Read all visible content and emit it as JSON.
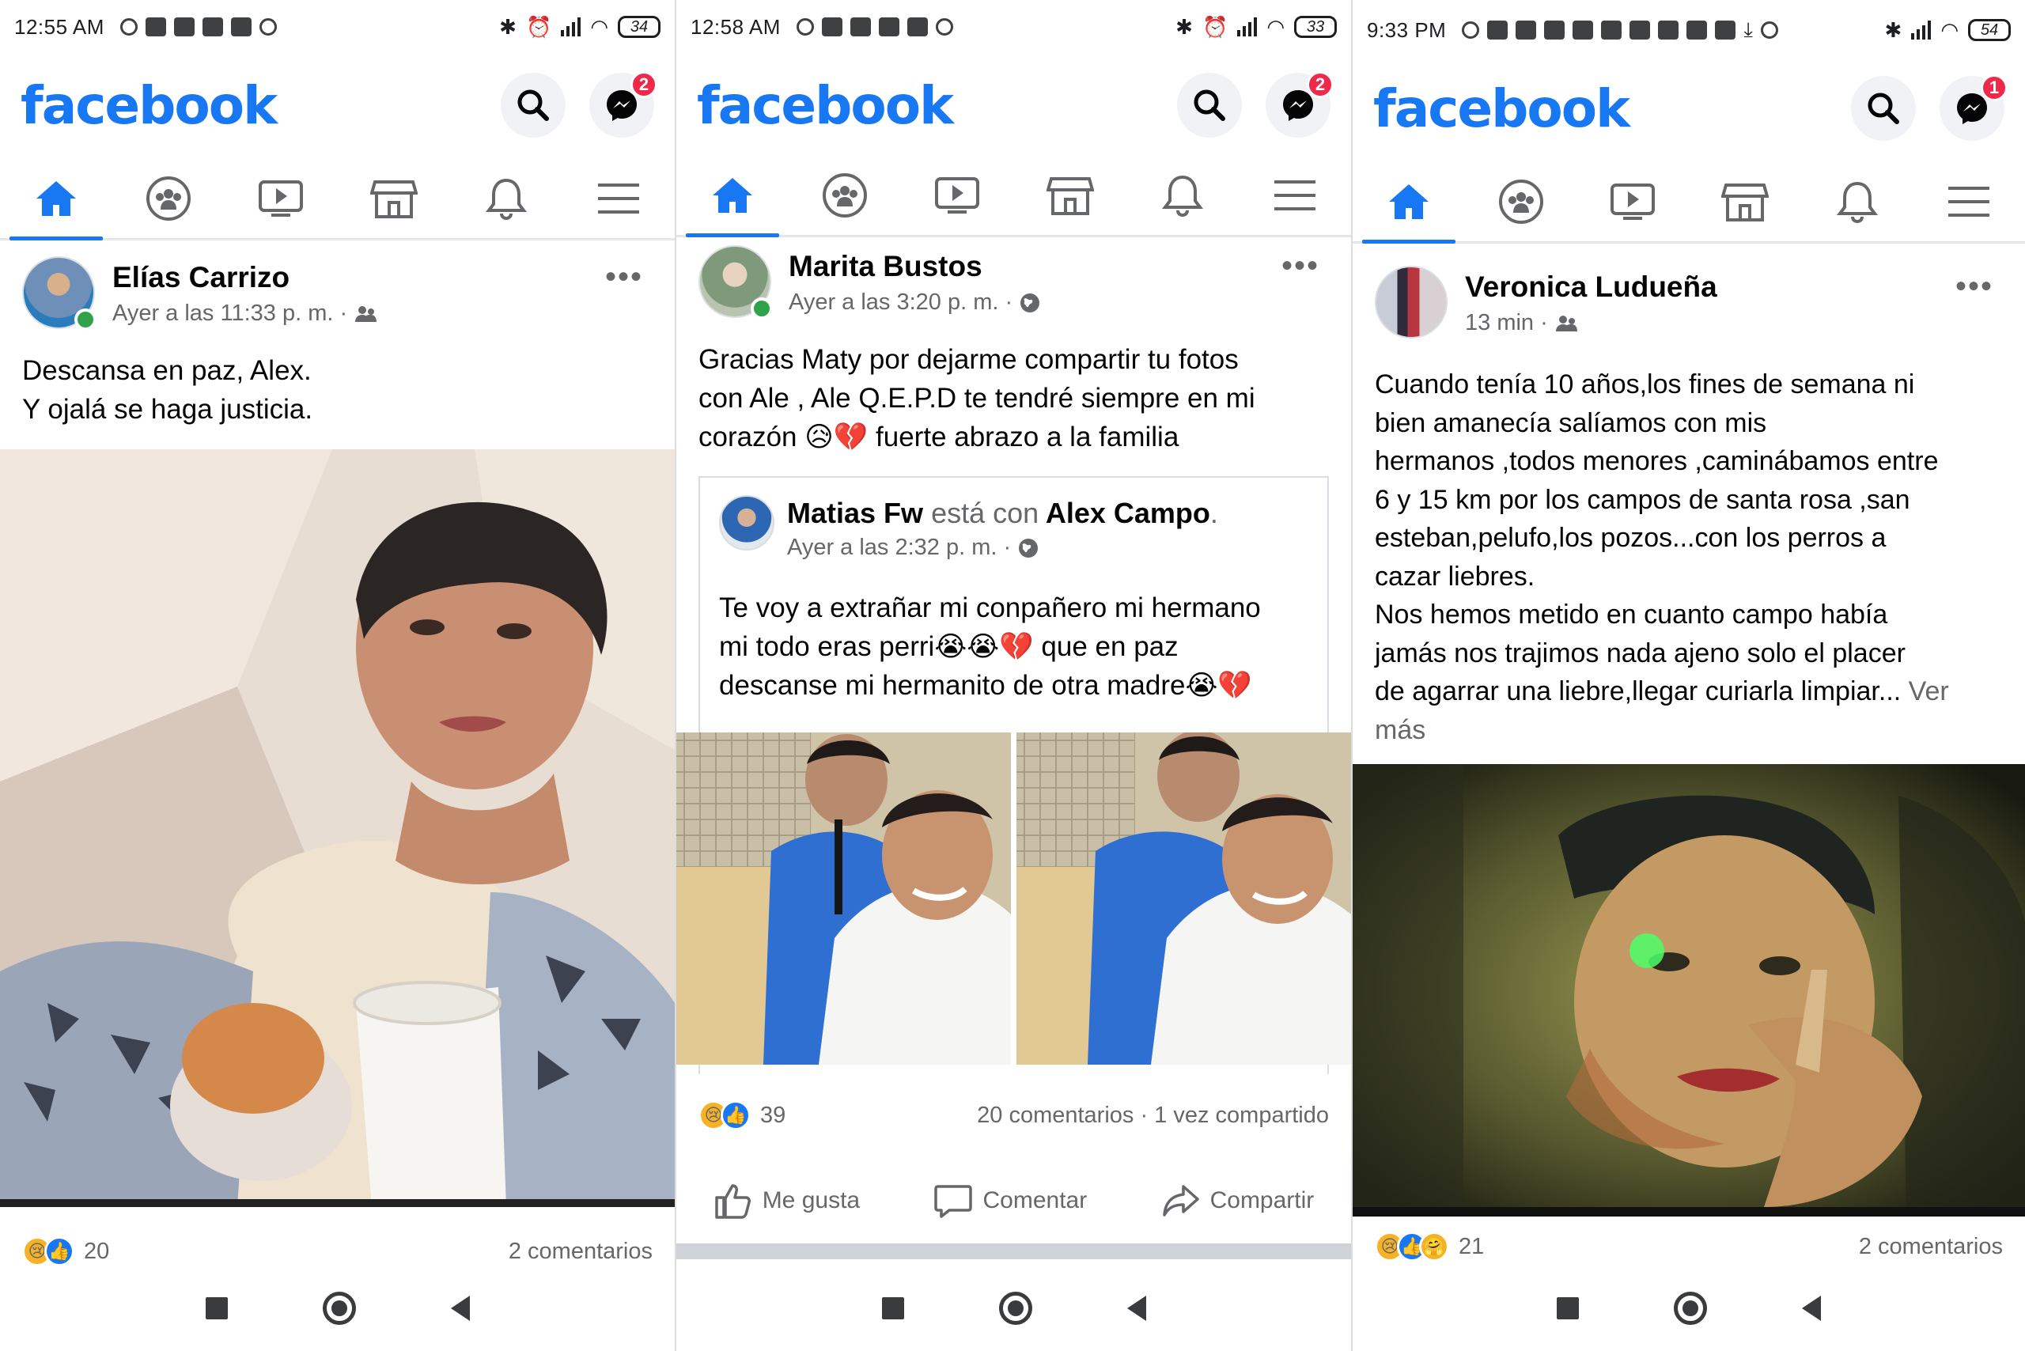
{
  "colors": {
    "brand": "#1877f2",
    "online": "#31a24c",
    "badge": "#f02849",
    "meta": "#65676b"
  },
  "panels": [
    {
      "status": {
        "time": "12:55 AM",
        "battery": "34"
      },
      "header": {
        "logo": "facebook",
        "messenger_badge": "2"
      },
      "tabs": [
        "home-icon",
        "groups-icon",
        "watch-icon",
        "marketplace-icon",
        "notifications-icon",
        "menu-icon"
      ],
      "post": {
        "author": "Elías Carrizo",
        "meta": "Ayer a las 11:33 p. m. ·",
        "privacy_icon": "friends-icon",
        "text": [
          "Descansa en paz, Alex.",
          "Y ojalá se haga justicia."
        ],
        "reaction_count": "20",
        "comments": "2 comentarios"
      }
    },
    {
      "status": {
        "time": "12:58 AM",
        "battery": "33"
      },
      "header": {
        "logo": "facebook",
        "messenger_badge": "2"
      },
      "tabs": [
        "home-icon",
        "groups-icon",
        "watch-icon",
        "marketplace-icon",
        "notifications-icon",
        "menu-icon"
      ],
      "post": {
        "author": "Marita Bustos",
        "meta": "Ayer a las 3:20 p. m. ·",
        "privacy_icon": "globe-icon",
        "text": [
          "Gracias Maty por dejarme compartir tu fotos",
          "con Ale , Ale Q.E.P.D te tendré siempre en mi",
          "corazón 😥💔 fuerte abrazo a la familia"
        ],
        "shared": {
          "author": "Matias Fw",
          "with_text": "está con",
          "tagged": "Alex Campo",
          "meta": "Ayer a las 2:32 p. m. ·",
          "text": [
            "Te voy a extrañar mi conpañero mi hermano",
            "mi todo eras perri😭😭💔  que en paz",
            "descanse mi hermanito de otra madre😭💔"
          ]
        },
        "reaction_count": "39",
        "comments": "20 comentarios · 1 vez compartido",
        "actions": {
          "like": "Me gusta",
          "comment": "Comentar",
          "share": "Compartir"
        }
      }
    },
    {
      "status": {
        "time": "9:33 PM",
        "battery": "54"
      },
      "header": {
        "logo": "facebook",
        "messenger_badge": "1"
      },
      "tabs": [
        "home-icon",
        "groups-icon",
        "watch-icon",
        "marketplace-icon",
        "notifications-icon",
        "menu-icon"
      ],
      "post": {
        "author": "Veronica Ludueña",
        "meta": "13 min ·",
        "privacy_icon": "friends-icon",
        "text": [
          "Cuando tenía 10 años,los fines de semana ni",
          "bien amanecía salíamos con mis",
          "hermanos ,todos menores ,caminábamos entre",
          "6 y 15 km por los campos de santa rosa ,san",
          "esteban,pelufo,los pozos...con los perros a",
          "cazar liebres.",
          "Nos hemos metido en cuanto campo había",
          "jamás nos trajimos nada ajeno solo el placer",
          "de agarrar una liebre,llegar curiarla limpiar..."
        ],
        "see_more": "Ver más",
        "reaction_count": "21",
        "comments": "2 comentarios"
      }
    }
  ]
}
